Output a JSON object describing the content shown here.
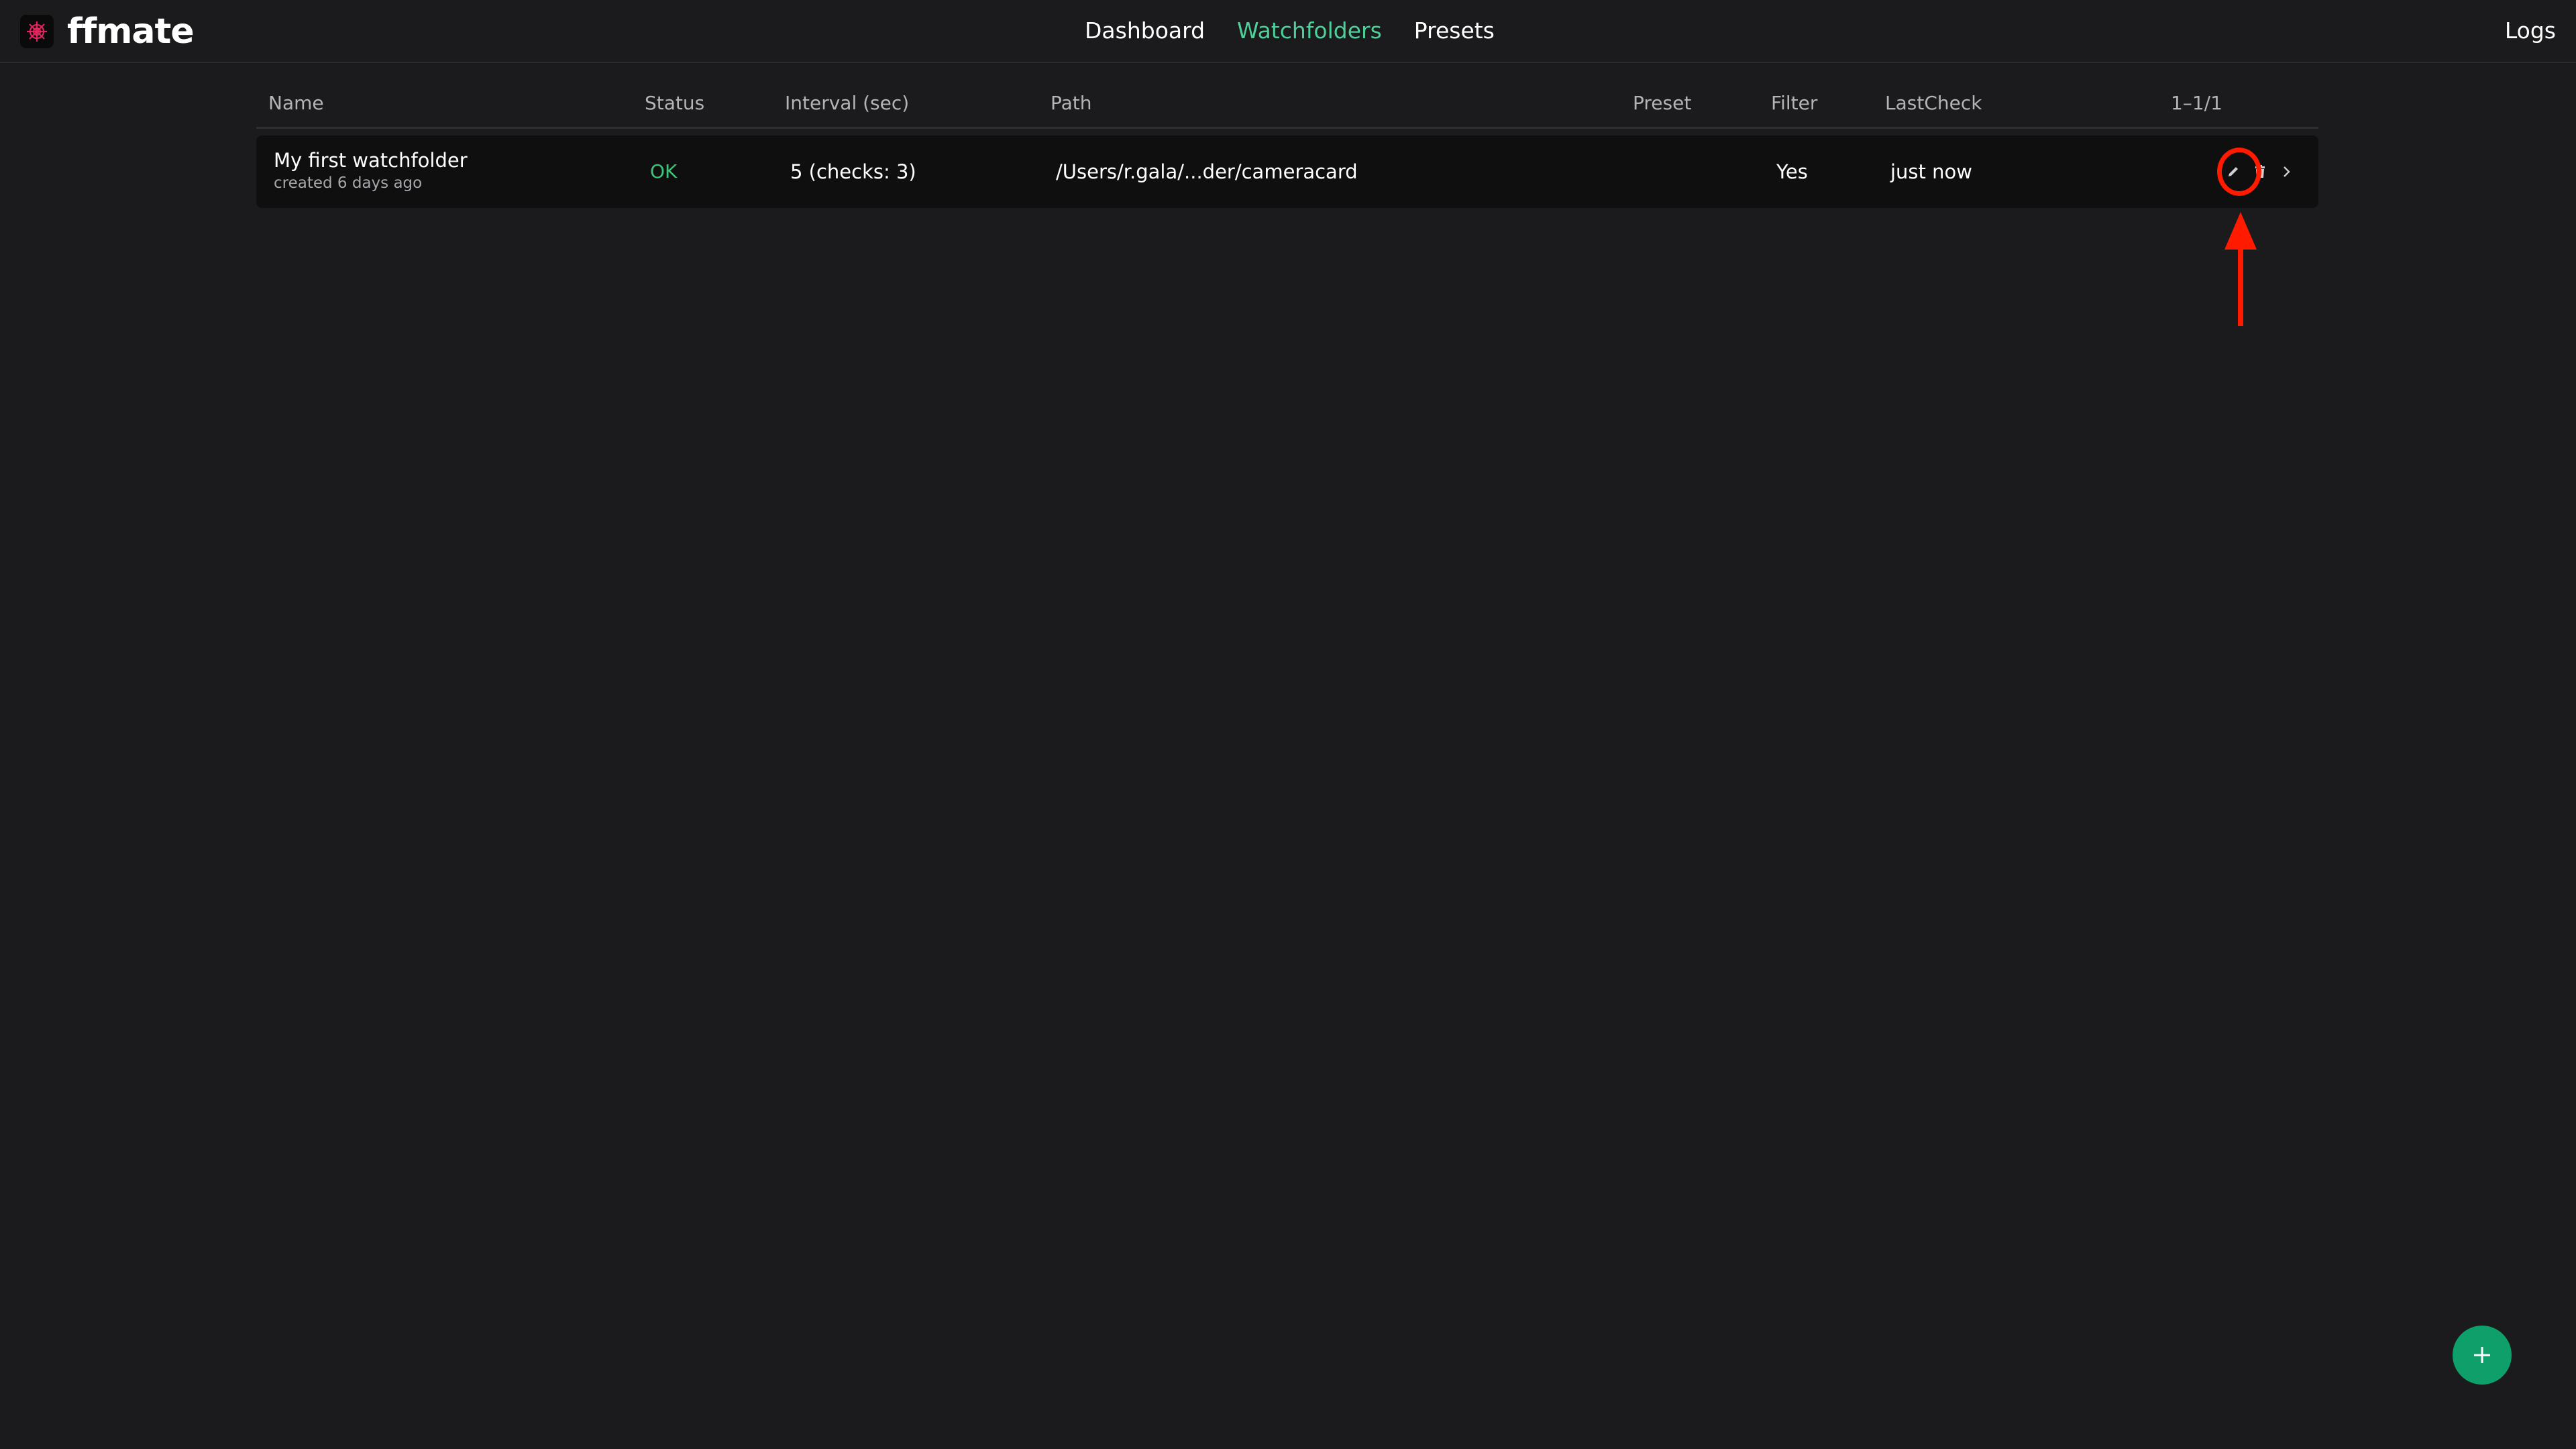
{
  "app": {
    "brand": "ffmate",
    "logo_icon": "ffmate-logo-icon"
  },
  "nav": {
    "items": [
      {
        "label": "Dashboard",
        "active": false
      },
      {
        "label": "Watchfolders",
        "active": true
      },
      {
        "label": "Presets",
        "active": false
      }
    ],
    "logs_label": "Logs"
  },
  "table": {
    "headers": {
      "name": "Name",
      "status": "Status",
      "interval": "Interval (sec)",
      "path": "Path",
      "preset": "Preset",
      "filter": "Filter",
      "lastcheck": "LastCheck",
      "pagination": "1–1/1"
    },
    "rows": [
      {
        "name": "My first watchfolder",
        "created": "created 6 days ago",
        "status": "OK",
        "interval": "5 (checks: 3)",
        "path": "/Users/r.gala/...der/cameracard",
        "preset": "",
        "filter": "Yes",
        "lastcheck": "just now",
        "actions": [
          "pencil-icon",
          "trash-icon",
          "chevron-right-icon"
        ]
      }
    ]
  },
  "colors": {
    "background": "#1b1b1d",
    "accent_nav": "#4ecf9a",
    "status_ok": "#3fc27a",
    "fab": "#0e9f6a",
    "annotation": "#ff1a00"
  },
  "fab": {
    "icon": "plus-icon"
  }
}
